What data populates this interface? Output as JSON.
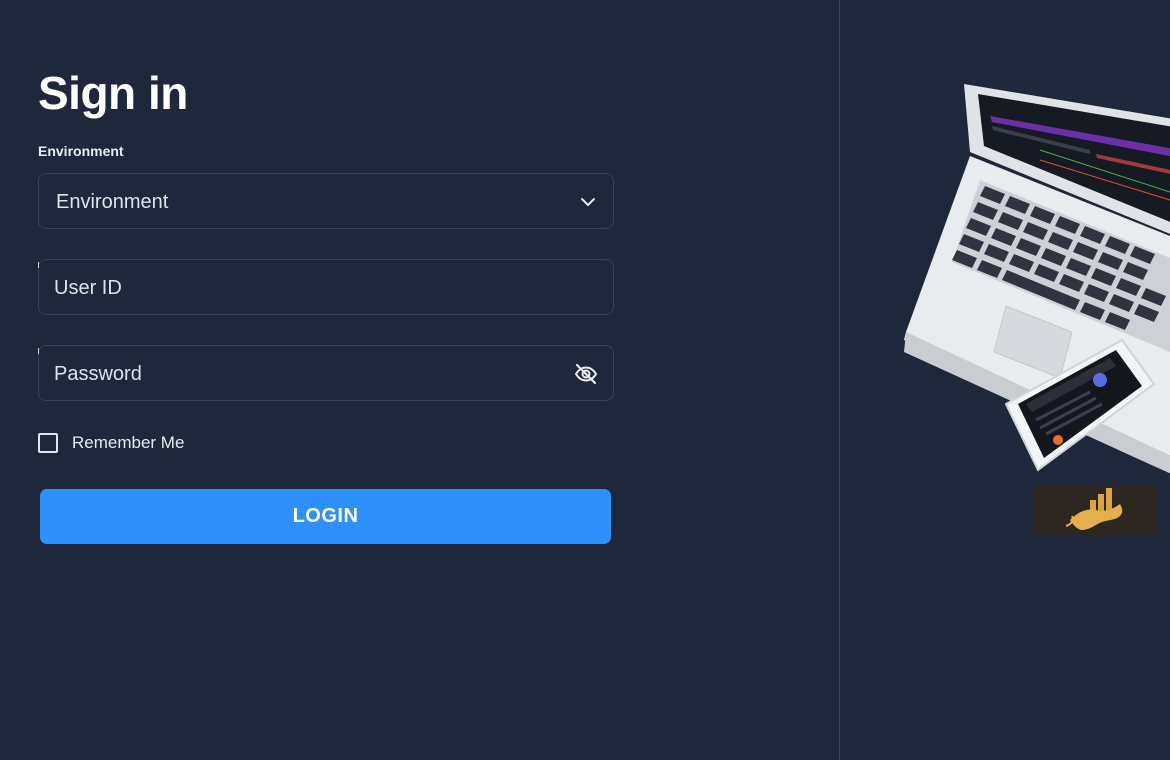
{
  "form": {
    "title": "Sign in",
    "environment_label": "Environment",
    "environment_value": "Environment",
    "user_id_placeholder": "User ID",
    "password_placeholder": "Password",
    "remember_label": "Remember Me",
    "remember_checked": false,
    "login_label": "LOGIN"
  },
  "icons": {
    "environment_dropdown": "chevron-down-icon",
    "password_toggle": "eye-slash-icon"
  },
  "colors": {
    "background": "#1e283a",
    "accent": "#2e90fa",
    "field_border": "#364255",
    "logo_gold": "#d9a441"
  }
}
